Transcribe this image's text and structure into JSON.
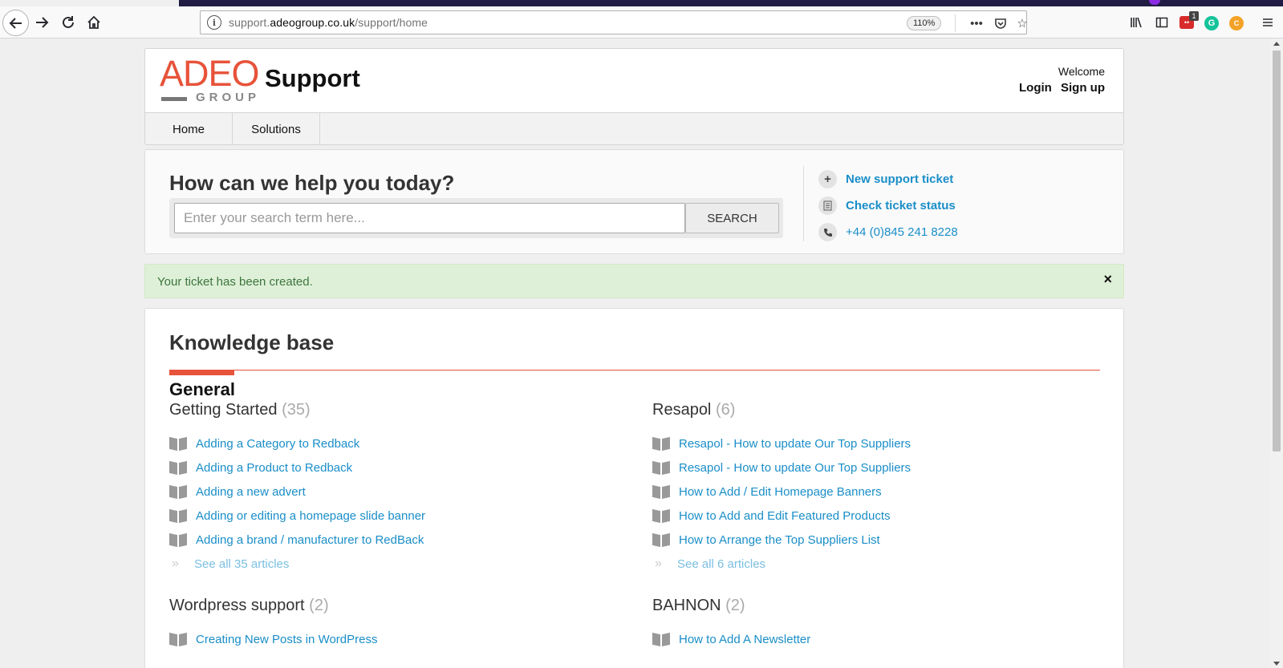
{
  "browser": {
    "url_prefix": "support.",
    "url_domain": "adeogroup.co.uk",
    "url_path": "/support/home",
    "zoom": "110%",
    "ext_badge_count": "1",
    "ext_green_letter": "G",
    "ext_orange_letter": "C"
  },
  "header": {
    "logo_text": "ADEO",
    "logo_subtext": "GROUP",
    "brand_title": "Support",
    "welcome": "Welcome",
    "login": "Login",
    "signup": "Sign up"
  },
  "nav": {
    "items": [
      {
        "label": "Home"
      },
      {
        "label": "Solutions"
      }
    ]
  },
  "help": {
    "title": "How can we help you today?",
    "search_placeholder": "Enter your search term here...",
    "search_button": "SEARCH",
    "links": [
      {
        "icon": "plus-icon",
        "label": "New support ticket"
      },
      {
        "icon": "document-icon",
        "label": "Check ticket status"
      },
      {
        "icon": "phone-icon",
        "label": "+44 (0)845 241 8228"
      }
    ]
  },
  "alert": {
    "text": "Your ticket has been created.",
    "close": "×"
  },
  "kb": {
    "title": "Knowledge base",
    "section": "General",
    "categories": [
      {
        "name": "Getting Started",
        "count": "(35)",
        "articles": [
          "Adding a Category to Redback",
          "Adding a Product to Redback",
          "Adding a new advert",
          "Adding or editing a homepage slide banner",
          "Adding a brand / manufacturer to RedBack"
        ],
        "see_all": "See all 35 articles"
      },
      {
        "name": "Resapol",
        "count": "(6)",
        "articles": [
          "Resapol - How to update Our Top Suppliers",
          "Resapol - How to update Our Top Suppliers",
          "How to Add / Edit Homepage Banners",
          "How to Add and Edit Featured Products",
          "How to Arrange the Top Suppliers List"
        ],
        "see_all": "See all 6 articles"
      },
      {
        "name": "Wordpress support",
        "count": "(2)",
        "articles": [
          "Creating New Posts in WordPress"
        ]
      },
      {
        "name": "BAHNON",
        "count": "(2)",
        "articles": [
          "How to Add A Newsletter"
        ]
      }
    ]
  },
  "colors": {
    "accent": "#e7533a",
    "link": "#1a8ec8",
    "alert_bg": "#dff0d8",
    "alert_text": "#3c763d"
  }
}
